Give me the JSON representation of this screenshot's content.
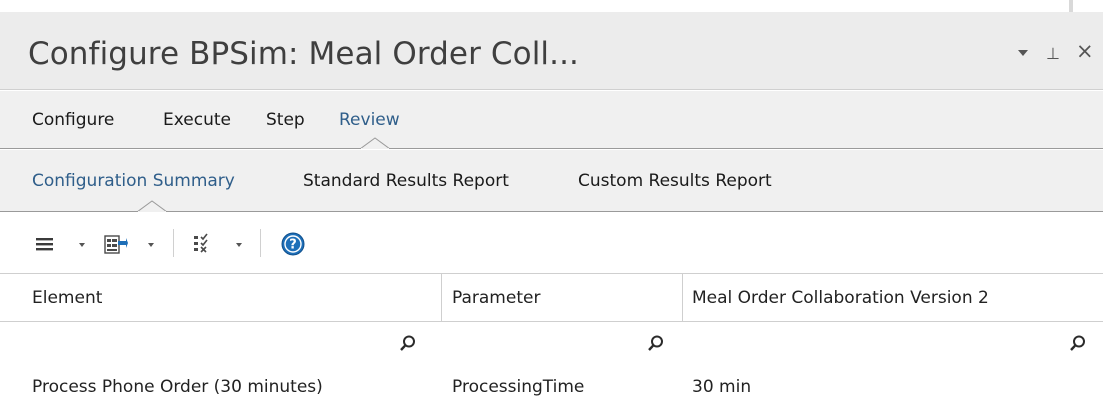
{
  "window": {
    "title": "Configure BPSim: Meal Order Coll...",
    "controls": {
      "dropdown": "▾",
      "pin": "⊥",
      "close": "×"
    }
  },
  "main_tabs": [
    {
      "label": "Configure",
      "active": false
    },
    {
      "label": "Execute",
      "active": false
    },
    {
      "label": "Step",
      "active": false
    },
    {
      "label": "Review",
      "active": true
    }
  ],
  "sub_tabs": [
    {
      "label": "Configuration Summary",
      "active": true
    },
    {
      "label": "Standard Results Report",
      "active": false
    },
    {
      "label": "Custom Results Report",
      "active": false
    }
  ],
  "toolbar": {
    "icons": [
      "menu-icon",
      "export-icon",
      "checklist-icon",
      "help-icon"
    ],
    "accent": "#1e6fb8"
  },
  "table": {
    "columns": [
      "Element",
      "Parameter",
      "Meal Order Collaboration Version 2"
    ],
    "rows": [
      {
        "element": "Process Phone Order (30 minutes)",
        "parameter": "ProcessingTime",
        "value": "30 min"
      }
    ]
  },
  "colors": {
    "title_bg": "#ececec",
    "tab_bg": "#f0f0f0",
    "active_tab": "#2f5e8a"
  }
}
